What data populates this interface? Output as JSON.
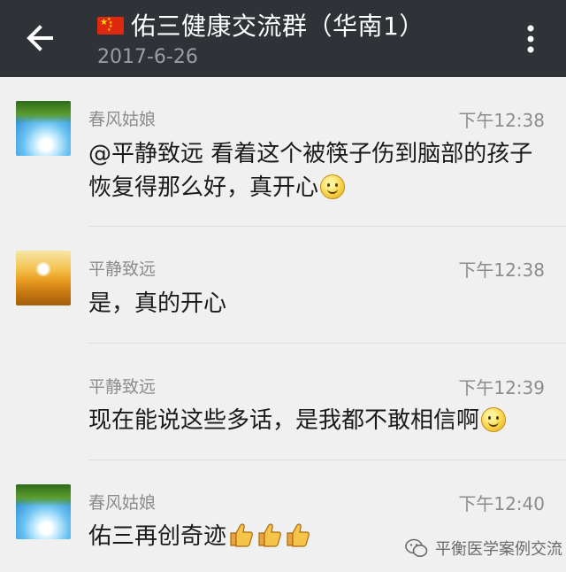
{
  "header": {
    "title": "佑三健康交流群（华南1）",
    "date": "2017-6-26",
    "flag_icon": "china-flag-icon"
  },
  "messages": [
    {
      "sender": "春风姑娘",
      "time": "下午12:38",
      "text": "@平静致远 看着这个被筷子伤到脑部的孩子恢复得那么好，真开心",
      "emoji": "smile"
    },
    {
      "sender": "平静致远",
      "time": "下午12:38",
      "text": "是，真的开心",
      "emoji": ""
    },
    {
      "sender": "平静致远",
      "time": "下午12:39",
      "text": "现在能说这些多话，是我都不敢相信啊",
      "emoji": "smile"
    },
    {
      "sender": "春风姑娘",
      "time": "下午12:40",
      "text": "佑三再创奇迹",
      "emoji": "thumbs-up x3"
    }
  ],
  "watermark": {
    "label": "平衡医学案例交流"
  },
  "colors": {
    "header_bg": "#2f3237",
    "body_bg": "#f0f0f0"
  }
}
